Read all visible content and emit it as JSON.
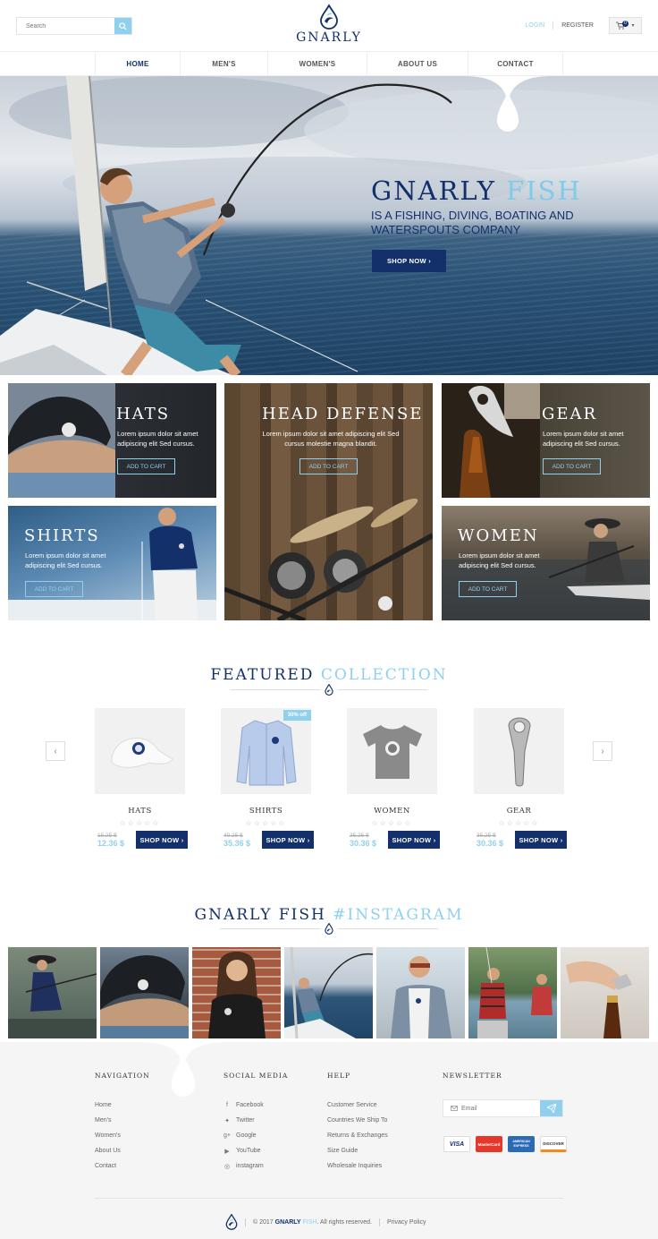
{
  "header": {
    "search_placeholder": "Search",
    "brand": "GNARLY",
    "login": "LOGIN",
    "register": "REGISTER",
    "cart_count": "0"
  },
  "nav": [
    "HOME",
    "MEN'S",
    "WOMEN'S",
    "ABOUT US",
    "CONTACT"
  ],
  "hero": {
    "title_main": "GNARLY",
    "title_accent": "FISH",
    "subtitle": "IS A FISHING, DIVING, BOATING AND WATERSPOUTS COMPANY",
    "button": "SHOP NOW ›"
  },
  "tiles": [
    {
      "title": "HATS",
      "text": "Lorem ipsum dolor sit amet adipiscing elit Sed cursus.",
      "button": "ADD TO CART"
    },
    {
      "title": "HEAD DEFENSE",
      "text": "Lorem ipsum dolor sit amet adipiscing elit Sed cursus molestie magna blandit.",
      "button": "ADD TO CART"
    },
    {
      "title": "GEAR",
      "text": "Lorem ipsum dolor sit amet adipiscing elit Sed cursus.",
      "button": "ADD TO CART"
    },
    {
      "title": "SHIRTS",
      "text": "Lorem ipsum dolor sit amet adipiscing elit Sed cursus.",
      "button": "ADD TO CART"
    },
    {
      "title": "WOMEN",
      "text": "Lorem ipsum dolor sit amet adipiscing elit Sed cursus.",
      "button": "ADD TO CART"
    }
  ],
  "featured": {
    "title_main": "FEATURED",
    "title_accent": "COLLECTION",
    "prev": "‹",
    "next": "›",
    "products": [
      {
        "name": "HATS",
        "stars": "☆☆☆☆☆",
        "old_price": "15.25 $",
        "price": "12.36 $",
        "button": "SHOP NOW ›"
      },
      {
        "name": "SHIRTS",
        "stars": "☆☆☆☆☆",
        "old_price": "40.25 $",
        "price": "35.36 $",
        "button": "SHOP NOW ›",
        "badge": "30% off"
      },
      {
        "name": "WOMEN",
        "stars": "☆☆☆☆☆",
        "old_price": "35.25 $",
        "price": "30.36 $",
        "button": "SHOP NOW ›"
      },
      {
        "name": "GEAR",
        "stars": "☆☆☆☆☆",
        "old_price": "35.25 $",
        "price": "30.36 $",
        "button": "SHOP NOW ›"
      }
    ]
  },
  "instagram": {
    "title_main": "GNARLY FISH",
    "title_accent": "#INSTAGRAM"
  },
  "footer": {
    "navigation": {
      "heading": "NAVIGATION",
      "items": [
        "Home",
        "Men's",
        "Women's",
        "About Us",
        "Contact"
      ]
    },
    "social": {
      "heading": "SOCIAL MEDIA",
      "items": [
        "Facebook",
        "Twitter",
        "Google",
        "YouTube",
        "instagram"
      ]
    },
    "help": {
      "heading": "HELP",
      "items": [
        "Customer Service",
        "Countries We Ship To",
        "Returns & Exchanges",
        "Size Guide",
        "Wholesale Inquiries"
      ]
    },
    "newsletter": {
      "heading": "NEWSLETTER",
      "placeholder": "Email"
    },
    "cards": [
      "VISA",
      "MasterCard",
      "AMERICAN EXPRESS",
      "DISCOVER"
    ],
    "copyright_prefix": "© 2017",
    "copyright_brand": "GNARLY",
    "copyright_brand2": "FISH",
    "copyright_suffix": ". All rights reserved.",
    "privacy": "Privacy Policy"
  },
  "colors": {
    "navy": "#13306a",
    "sky": "#8fd0ef"
  }
}
